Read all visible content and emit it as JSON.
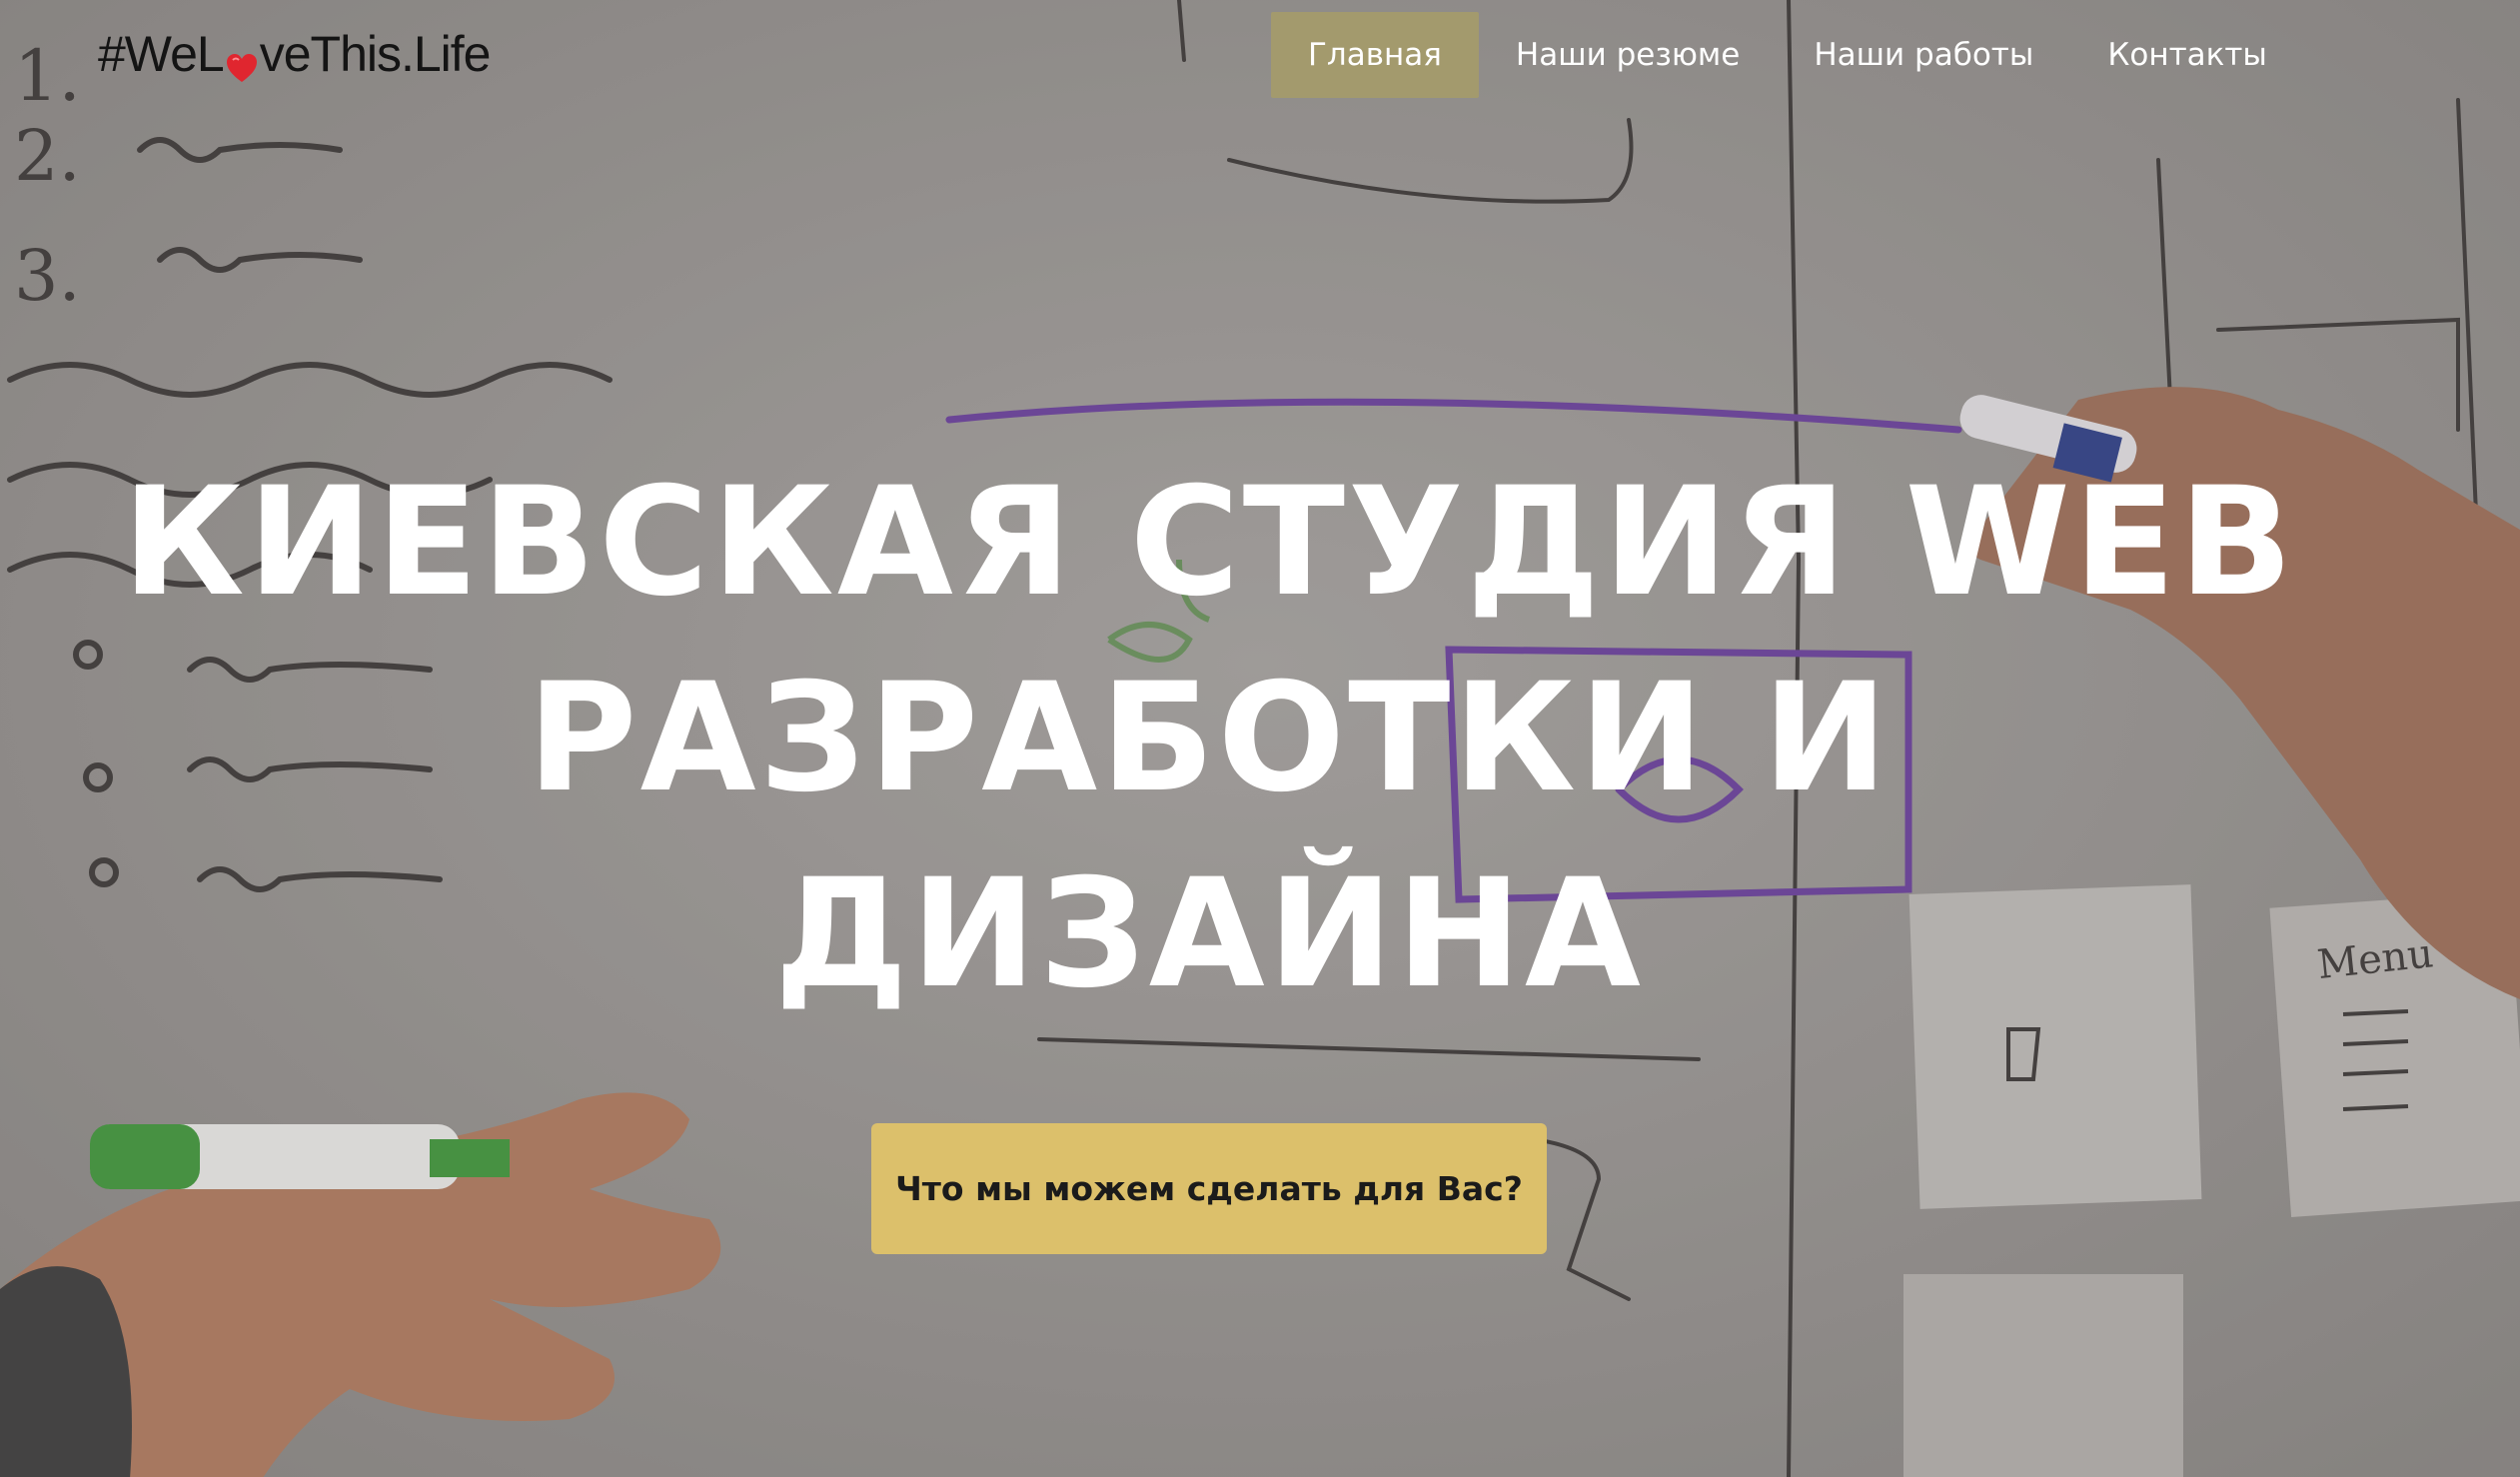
{
  "logo": {
    "prefix": "#WeL",
    "suffix": "veThis.Life",
    "heart_color": "#e0262f"
  },
  "nav": {
    "items": [
      {
        "label": "Главная",
        "active": true
      },
      {
        "label": "Наши резюме",
        "active": false
      },
      {
        "label": "Наши работы",
        "active": false
      },
      {
        "label": "Контакты",
        "active": false
      }
    ]
  },
  "hero": {
    "headline_line1": "КИЕВСКАЯ СТУДИЯ WEB",
    "headline_line2": "РАЗРАБОТКИ И",
    "headline_line3": "ДИЗАЙНА",
    "cta_label": "Что мы можем сделать для Вас?"
  },
  "colors": {
    "nav_active_bg": "#a39a6d",
    "cta_bg": "#dcc06b",
    "headline_text": "#ffffff",
    "overlay": "#7f7c79"
  }
}
